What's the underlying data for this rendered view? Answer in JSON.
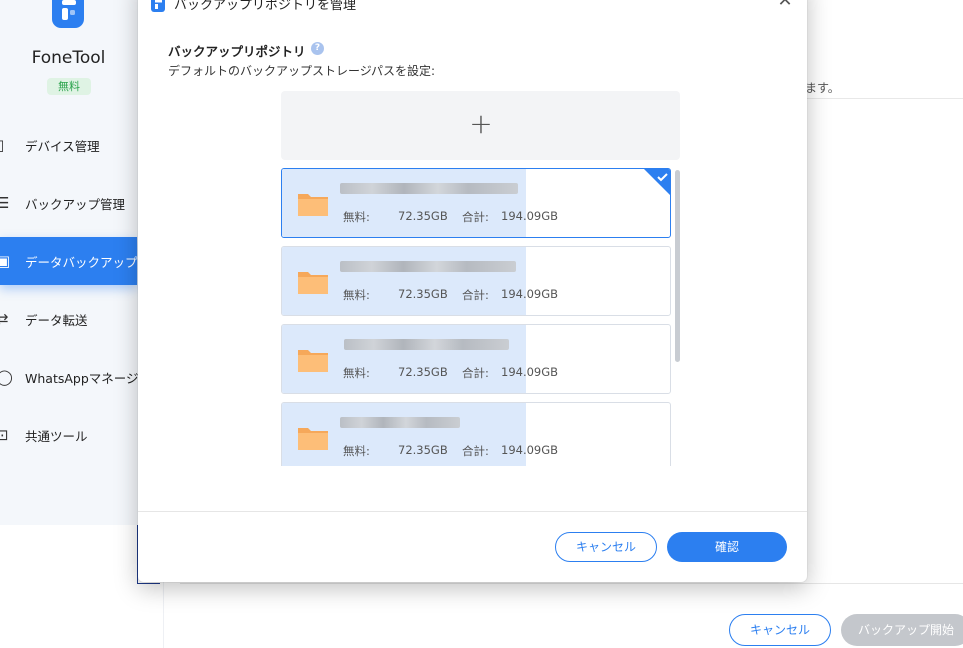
{
  "app": {
    "brand": "FoneTool",
    "badge": "無料",
    "nav": [
      {
        "label": "デバイス管理",
        "icon": "phone-icon",
        "active": false
      },
      {
        "label": "バックアップ管理",
        "icon": "list-icon",
        "active": false
      },
      {
        "label": "データバックアップ",
        "icon": "backup-icon",
        "active": true
      },
      {
        "label": "データ転送",
        "icon": "transfer-icon",
        "active": false
      },
      {
        "label": "WhatsAppマネージャ",
        "icon": "whatsapp-icon",
        "active": false
      },
      {
        "label": "共通ツール",
        "icon": "toolbox-icon",
        "active": false
      }
    ],
    "background_text": "ます。",
    "cancel_label": "キャンセル",
    "start_label": "バックアップ開始"
  },
  "dialog": {
    "title": "バックアップリポジトリを管理",
    "section_title": "バックアップリポジトリ",
    "section_subtitle": "デフォルトのバックアップストレージパスを設定:",
    "add_icon": "plus-icon",
    "repositories": [
      {
        "free_label": "無料:",
        "free": "72.35GB",
        "total_label": "合計:",
        "total": "194.09GB",
        "used_fraction": 0.63,
        "selected": true
      },
      {
        "free_label": "無料:",
        "free": "72.35GB",
        "total_label": "合計:",
        "total": "194.09GB",
        "used_fraction": 0.63,
        "selected": false
      },
      {
        "free_label": "無料:",
        "free": "72.35GB",
        "total_label": "合計:",
        "total": "194.09GB",
        "used_fraction": 0.63,
        "selected": false
      },
      {
        "free_label": "無料:",
        "free": "72.35GB",
        "total_label": "合計:",
        "total": "194.09GB",
        "used_fraction": 0.63,
        "selected": false
      }
    ],
    "cancel_label": "キャンセル",
    "ok_label": "確認"
  },
  "colors": {
    "accent": "#2c7ff0",
    "usage_fill": "#dce9fb",
    "folder": "#f6a85a",
    "badge_bg": "#dff3e4",
    "badge_text": "#2fa550"
  }
}
